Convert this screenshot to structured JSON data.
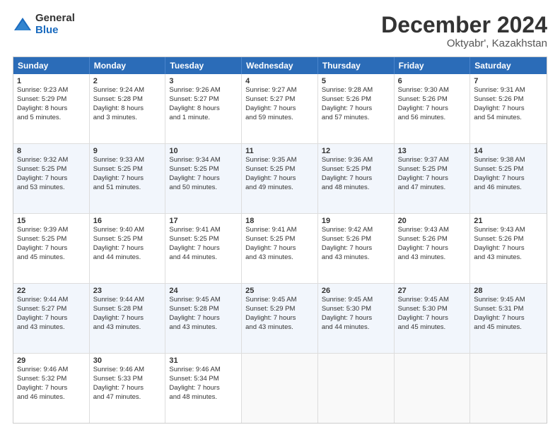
{
  "logo": {
    "general": "General",
    "blue": "Blue"
  },
  "header": {
    "title": "December 2024",
    "subtitle": "Oktyabr', Kazakhstan"
  },
  "weekdays": [
    "Sunday",
    "Monday",
    "Tuesday",
    "Wednesday",
    "Thursday",
    "Friday",
    "Saturday"
  ],
  "rows": [
    [
      {
        "day": "1",
        "lines": [
          "Sunrise: 9:23 AM",
          "Sunset: 5:29 PM",
          "Daylight: 8 hours",
          "and 5 minutes."
        ]
      },
      {
        "day": "2",
        "lines": [
          "Sunrise: 9:24 AM",
          "Sunset: 5:28 PM",
          "Daylight: 8 hours",
          "and 3 minutes."
        ]
      },
      {
        "day": "3",
        "lines": [
          "Sunrise: 9:26 AM",
          "Sunset: 5:27 PM",
          "Daylight: 8 hours",
          "and 1 minute."
        ]
      },
      {
        "day": "4",
        "lines": [
          "Sunrise: 9:27 AM",
          "Sunset: 5:27 PM",
          "Daylight: 7 hours",
          "and 59 minutes."
        ]
      },
      {
        "day": "5",
        "lines": [
          "Sunrise: 9:28 AM",
          "Sunset: 5:26 PM",
          "Daylight: 7 hours",
          "and 57 minutes."
        ]
      },
      {
        "day": "6",
        "lines": [
          "Sunrise: 9:30 AM",
          "Sunset: 5:26 PM",
          "Daylight: 7 hours",
          "and 56 minutes."
        ]
      },
      {
        "day": "7",
        "lines": [
          "Sunrise: 9:31 AM",
          "Sunset: 5:26 PM",
          "Daylight: 7 hours",
          "and 54 minutes."
        ]
      }
    ],
    [
      {
        "day": "8",
        "lines": [
          "Sunrise: 9:32 AM",
          "Sunset: 5:25 PM",
          "Daylight: 7 hours",
          "and 53 minutes."
        ]
      },
      {
        "day": "9",
        "lines": [
          "Sunrise: 9:33 AM",
          "Sunset: 5:25 PM",
          "Daylight: 7 hours",
          "and 51 minutes."
        ]
      },
      {
        "day": "10",
        "lines": [
          "Sunrise: 9:34 AM",
          "Sunset: 5:25 PM",
          "Daylight: 7 hours",
          "and 50 minutes."
        ]
      },
      {
        "day": "11",
        "lines": [
          "Sunrise: 9:35 AM",
          "Sunset: 5:25 PM",
          "Daylight: 7 hours",
          "and 49 minutes."
        ]
      },
      {
        "day": "12",
        "lines": [
          "Sunrise: 9:36 AM",
          "Sunset: 5:25 PM",
          "Daylight: 7 hours",
          "and 48 minutes."
        ]
      },
      {
        "day": "13",
        "lines": [
          "Sunrise: 9:37 AM",
          "Sunset: 5:25 PM",
          "Daylight: 7 hours",
          "and 47 minutes."
        ]
      },
      {
        "day": "14",
        "lines": [
          "Sunrise: 9:38 AM",
          "Sunset: 5:25 PM",
          "Daylight: 7 hours",
          "and 46 minutes."
        ]
      }
    ],
    [
      {
        "day": "15",
        "lines": [
          "Sunrise: 9:39 AM",
          "Sunset: 5:25 PM",
          "Daylight: 7 hours",
          "and 45 minutes."
        ]
      },
      {
        "day": "16",
        "lines": [
          "Sunrise: 9:40 AM",
          "Sunset: 5:25 PM",
          "Daylight: 7 hours",
          "and 44 minutes."
        ]
      },
      {
        "day": "17",
        "lines": [
          "Sunrise: 9:41 AM",
          "Sunset: 5:25 PM",
          "Daylight: 7 hours",
          "and 44 minutes."
        ]
      },
      {
        "day": "18",
        "lines": [
          "Sunrise: 9:41 AM",
          "Sunset: 5:25 PM",
          "Daylight: 7 hours",
          "and 43 minutes."
        ]
      },
      {
        "day": "19",
        "lines": [
          "Sunrise: 9:42 AM",
          "Sunset: 5:26 PM",
          "Daylight: 7 hours",
          "and 43 minutes."
        ]
      },
      {
        "day": "20",
        "lines": [
          "Sunrise: 9:43 AM",
          "Sunset: 5:26 PM",
          "Daylight: 7 hours",
          "and 43 minutes."
        ]
      },
      {
        "day": "21",
        "lines": [
          "Sunrise: 9:43 AM",
          "Sunset: 5:26 PM",
          "Daylight: 7 hours",
          "and 43 minutes."
        ]
      }
    ],
    [
      {
        "day": "22",
        "lines": [
          "Sunrise: 9:44 AM",
          "Sunset: 5:27 PM",
          "Daylight: 7 hours",
          "and 43 minutes."
        ]
      },
      {
        "day": "23",
        "lines": [
          "Sunrise: 9:44 AM",
          "Sunset: 5:28 PM",
          "Daylight: 7 hours",
          "and 43 minutes."
        ]
      },
      {
        "day": "24",
        "lines": [
          "Sunrise: 9:45 AM",
          "Sunset: 5:28 PM",
          "Daylight: 7 hours",
          "and 43 minutes."
        ]
      },
      {
        "day": "25",
        "lines": [
          "Sunrise: 9:45 AM",
          "Sunset: 5:29 PM",
          "Daylight: 7 hours",
          "and 43 minutes."
        ]
      },
      {
        "day": "26",
        "lines": [
          "Sunrise: 9:45 AM",
          "Sunset: 5:30 PM",
          "Daylight: 7 hours",
          "and 44 minutes."
        ]
      },
      {
        "day": "27",
        "lines": [
          "Sunrise: 9:45 AM",
          "Sunset: 5:30 PM",
          "Daylight: 7 hours",
          "and 45 minutes."
        ]
      },
      {
        "day": "28",
        "lines": [
          "Sunrise: 9:45 AM",
          "Sunset: 5:31 PM",
          "Daylight: 7 hours",
          "and 45 minutes."
        ]
      }
    ],
    [
      {
        "day": "29",
        "lines": [
          "Sunrise: 9:46 AM",
          "Sunset: 5:32 PM",
          "Daylight: 7 hours",
          "and 46 minutes."
        ]
      },
      {
        "day": "30",
        "lines": [
          "Sunrise: 9:46 AM",
          "Sunset: 5:33 PM",
          "Daylight: 7 hours",
          "and 47 minutes."
        ]
      },
      {
        "day": "31",
        "lines": [
          "Sunrise: 9:46 AM",
          "Sunset: 5:34 PM",
          "Daylight: 7 hours",
          "and 48 minutes."
        ]
      },
      {
        "day": "",
        "lines": []
      },
      {
        "day": "",
        "lines": []
      },
      {
        "day": "",
        "lines": []
      },
      {
        "day": "",
        "lines": []
      }
    ]
  ]
}
